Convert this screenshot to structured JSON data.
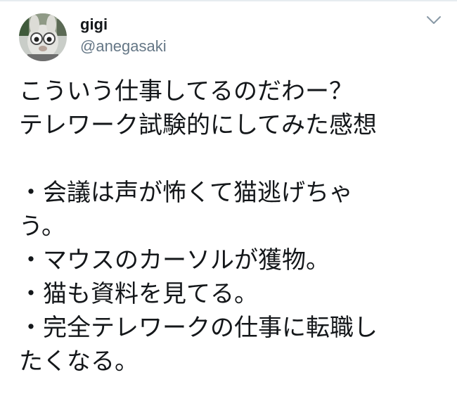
{
  "tweet": {
    "author": {
      "display_name": "gigi",
      "handle": "@anegasaki",
      "avatar_icon": "avatar-icon"
    },
    "menu_icon": "chevron-down-icon",
    "lines": [
      "こういう仕事してるのだわー？",
      "テレワーク試験的にしてみた感想",
      "",
      "・会議は声が怖くて猫逃げちゃ",
      "う。",
      "・マウスのカーソルが獲物。",
      "・猫も資料を見てる。",
      "・完全テレワークの仕事に転職し",
      "たくなる。"
    ]
  },
  "colors": {
    "text": "#14171a",
    "secondary_text": "#657786",
    "divider": "#e6ecf0",
    "chevron": "#8899a6"
  }
}
